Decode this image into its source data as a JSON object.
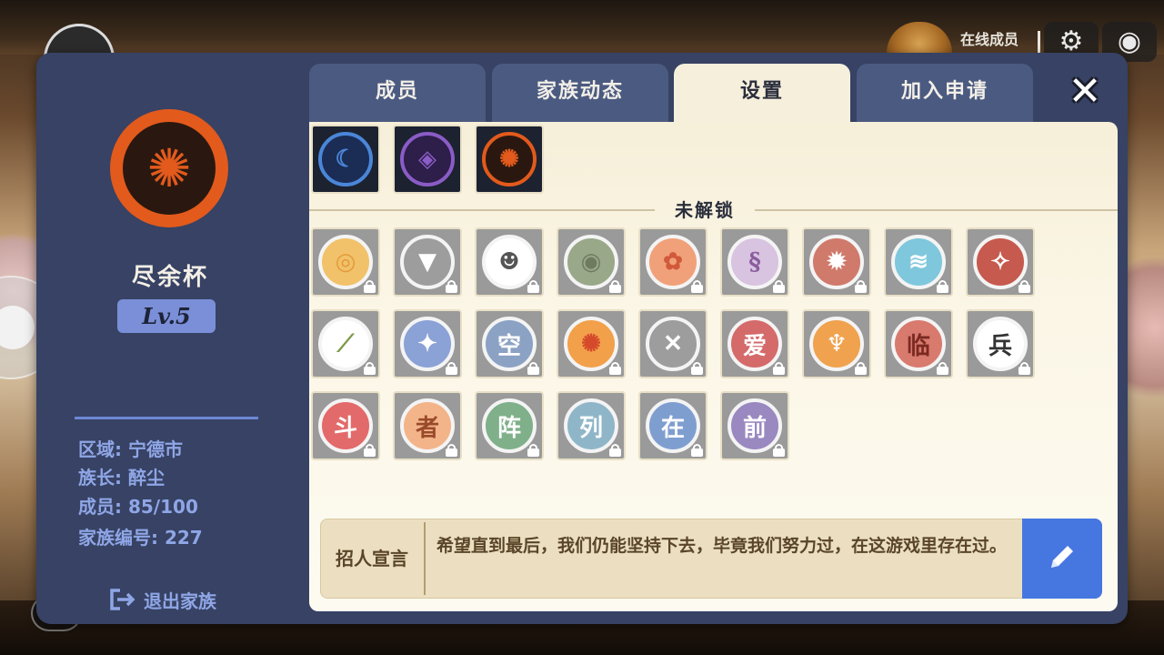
{
  "hud": {
    "online_label": "在线成员",
    "gear_icon": "gear-icon",
    "eye_icon": "eye-icon"
  },
  "sidebar": {
    "family_name": "尽余杯",
    "level": "Lv.5",
    "info": [
      {
        "label": "区域:",
        "value": "宁德市"
      },
      {
        "label": "族长:",
        "value": "醉尘"
      },
      {
        "label": "成员:",
        "value": "85/100"
      },
      {
        "label": "家族编号:",
        "value": "227"
      }
    ],
    "leave_label": "退出家族"
  },
  "tabs": [
    {
      "label": "成员",
      "active": false
    },
    {
      "label": "家族动态",
      "active": false
    },
    {
      "label": "设置",
      "active": true
    },
    {
      "label": "加入申请",
      "active": false
    }
  ],
  "close_icon": "close-icon",
  "emblems": {
    "unlocked": [
      {
        "name": "moon-emblem",
        "glyph": "☾",
        "ring": "#4a86d8",
        "fill": "#1b2c55",
        "color": "#4a86d8"
      },
      {
        "name": "tomoe-emblem",
        "glyph": "◈",
        "ring": "#8a5cc6",
        "fill": "#2d1e4a",
        "color": "#8a5cc6"
      },
      {
        "name": "flame-emblem",
        "glyph": "✺",
        "ring": "#e25a1c",
        "fill": "#2a1810",
        "color": "#e25a1c"
      }
    ],
    "locked_label": "未解锁",
    "locked": [
      {
        "name": "sun-swirl-emblem",
        "glyph": "◎",
        "fill": "#f1c26a",
        "color": "#e49a3a"
      },
      {
        "name": "shield-emblem",
        "glyph": "▼",
        "fill": "#9d9d9d",
        "color": "#ffffff"
      },
      {
        "name": "ghost-emblem",
        "glyph": "☻",
        "fill": "#ffffff",
        "color": "#555555"
      },
      {
        "name": "spiral-emblem",
        "glyph": "◉",
        "fill": "#9aa88a",
        "color": "#6f7b5e"
      },
      {
        "name": "pig-emblem",
        "glyph": "✿",
        "fill": "#f1a17a",
        "color": "#d15a3a"
      },
      {
        "name": "swirl-purple-emblem",
        "glyph": "§",
        "fill": "#d8c3e0",
        "color": "#8a5c9e"
      },
      {
        "name": "fox-mask-emblem",
        "glyph": "✹",
        "fill": "#d07a6c",
        "color": "#ffffff"
      },
      {
        "name": "wave-emblem",
        "glyph": "≋",
        "fill": "#7fc7dc",
        "color": "#ffffff"
      },
      {
        "name": "triple-tomoe-emblem",
        "glyph": "✧",
        "fill": "#c65a4e",
        "color": "#ffffff"
      },
      {
        "name": "bamboo-emblem",
        "glyph": "⟋",
        "fill": "#ffffff",
        "color": "#7c9a4a"
      },
      {
        "name": "kunai-emblem",
        "glyph": "✦",
        "fill": "#8ba2d6",
        "color": "#ffffff"
      },
      {
        "name": "kanji-kong-emblem",
        "glyph": "空",
        "fill": "#8ba2c4",
        "color": "#ffffff"
      },
      {
        "name": "fire-orb-emblem",
        "glyph": "✺",
        "fill": "#f2a04a",
        "color": "#d44a2a"
      },
      {
        "name": "swords-emblem",
        "glyph": "✕",
        "fill": "#9d9d9d",
        "color": "#ffffff"
      },
      {
        "name": "kanji-ai-emblem",
        "glyph": "爱",
        "fill": "#d56a6a",
        "color": "#ffffff"
      },
      {
        "name": "phoenix-emblem",
        "glyph": "♆",
        "fill": "#f0a24e",
        "color": "#ffffff"
      },
      {
        "name": "kanji-lin-emblem",
        "glyph": "临",
        "fill": "#d87a6e",
        "color": "#7b2a22"
      },
      {
        "name": "kanji-bing-emblem",
        "glyph": "兵",
        "fill": "#ffffff",
        "color": "#333333"
      },
      {
        "name": "kanji-dou-emblem",
        "glyph": "斗",
        "fill": "#e36a6a",
        "color": "#ffffff"
      },
      {
        "name": "kanji-zhe-emblem",
        "glyph": "者",
        "fill": "#f3b48a",
        "color": "#9a4a2a"
      },
      {
        "name": "kanji-zhen-emblem",
        "glyph": "阵",
        "fill": "#7fb08a",
        "color": "#ffffff"
      },
      {
        "name": "kanji-lie-emblem",
        "glyph": "列",
        "fill": "#8fb6c8",
        "color": "#ffffff"
      },
      {
        "name": "kanji-zai-emblem",
        "glyph": "在",
        "fill": "#7f9ed0",
        "color": "#ffffff"
      },
      {
        "name": "kanji-qian-emblem",
        "glyph": "前",
        "fill": "#9a88c0",
        "color": "#ffffff"
      }
    ]
  },
  "slogan": {
    "label": "招人宣言",
    "text": "希望直到最后，我们仍能坚持下去，毕竟我们努力过，在这游戏里存在过。",
    "edit_icon": "pencil-icon"
  }
}
